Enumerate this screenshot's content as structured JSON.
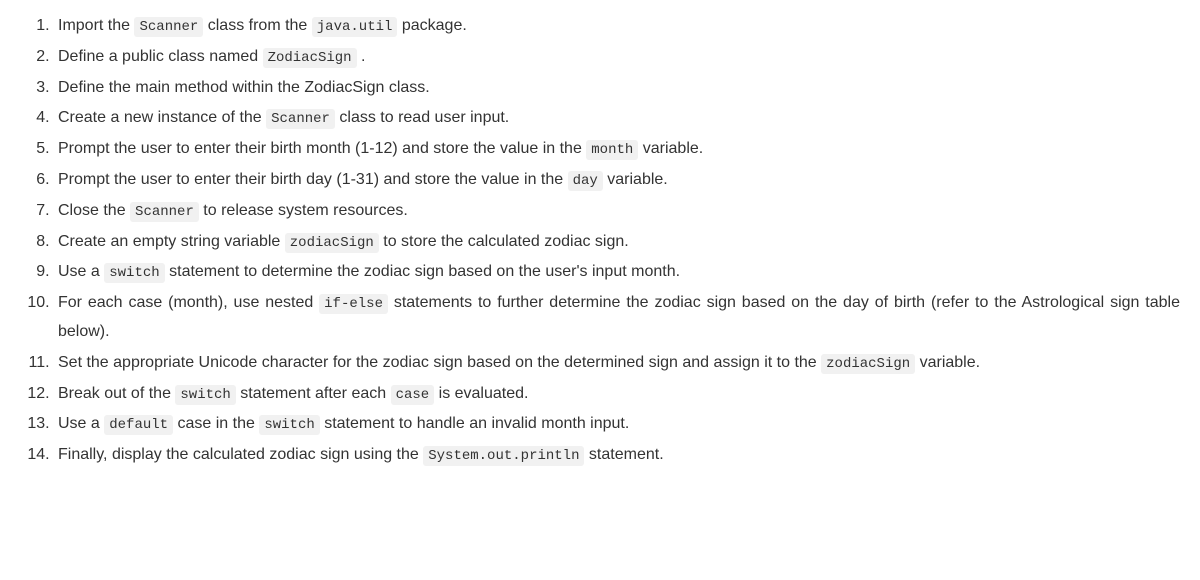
{
  "steps": [
    {
      "parts": [
        {
          "type": "text",
          "value": "Import the "
        },
        {
          "type": "code",
          "value": "Scanner"
        },
        {
          "type": "text",
          "value": " class from the "
        },
        {
          "type": "code",
          "value": "java.util"
        },
        {
          "type": "text",
          "value": " package."
        }
      ]
    },
    {
      "parts": [
        {
          "type": "text",
          "value": "Define a public class named "
        },
        {
          "type": "code",
          "value": "ZodiacSign"
        },
        {
          "type": "text",
          "value": " ."
        }
      ]
    },
    {
      "parts": [
        {
          "type": "text",
          "value": "Define the main method within the ZodiacSign class."
        }
      ]
    },
    {
      "parts": [
        {
          "type": "text",
          "value": "Create a new instance of the "
        },
        {
          "type": "code",
          "value": "Scanner"
        },
        {
          "type": "text",
          "value": " class to read user input."
        }
      ]
    },
    {
      "parts": [
        {
          "type": "text",
          "value": "Prompt the user to enter their birth month (1-12) and store the value in the "
        },
        {
          "type": "code",
          "value": "month"
        },
        {
          "type": "text",
          "value": " variable."
        }
      ]
    },
    {
      "parts": [
        {
          "type": "text",
          "value": "Prompt the user to enter their birth day (1-31) and store the value in the "
        },
        {
          "type": "code",
          "value": "day"
        },
        {
          "type": "text",
          "value": " variable."
        }
      ]
    },
    {
      "parts": [
        {
          "type": "text",
          "value": "Close the "
        },
        {
          "type": "code",
          "value": "Scanner"
        },
        {
          "type": "text",
          "value": " to release system resources."
        }
      ]
    },
    {
      "parts": [
        {
          "type": "text",
          "value": "Create an empty string variable "
        },
        {
          "type": "code",
          "value": "zodiacSign"
        },
        {
          "type": "text",
          "value": " to store the calculated zodiac sign."
        }
      ]
    },
    {
      "parts": [
        {
          "type": "text",
          "value": "Use a "
        },
        {
          "type": "code",
          "value": "switch"
        },
        {
          "type": "text",
          "value": " statement to determine the zodiac sign based on the user's input month."
        }
      ]
    },
    {
      "parts": [
        {
          "type": "text",
          "value": "For each case (month), use nested "
        },
        {
          "type": "code",
          "value": "if-else"
        },
        {
          "type": "text",
          "value": " statements to further determine the zodiac sign based on the day of birth (refer to the Astrological sign table below)."
        }
      ]
    },
    {
      "parts": [
        {
          "type": "text",
          "value": "Set the appropriate Unicode character for the zodiac sign based on the determined sign and assign it to the "
        },
        {
          "type": "code",
          "value": "zodiacSign"
        },
        {
          "type": "text",
          "value": " variable."
        }
      ]
    },
    {
      "parts": [
        {
          "type": "text",
          "value": "Break out of the "
        },
        {
          "type": "code",
          "value": "switch"
        },
        {
          "type": "text",
          "value": " statement after each "
        },
        {
          "type": "code",
          "value": "case"
        },
        {
          "type": "text",
          "value": " is evaluated."
        }
      ]
    },
    {
      "parts": [
        {
          "type": "text",
          "value": "Use a "
        },
        {
          "type": "code",
          "value": "default"
        },
        {
          "type": "text",
          "value": " case in the "
        },
        {
          "type": "code",
          "value": "switch"
        },
        {
          "type": "text",
          "value": " statement to handle an invalid month input."
        }
      ]
    },
    {
      "parts": [
        {
          "type": "text",
          "value": "Finally, display the calculated zodiac sign using the "
        },
        {
          "type": "code",
          "value": "System.out.println"
        },
        {
          "type": "text",
          "value": " statement."
        }
      ]
    }
  ]
}
